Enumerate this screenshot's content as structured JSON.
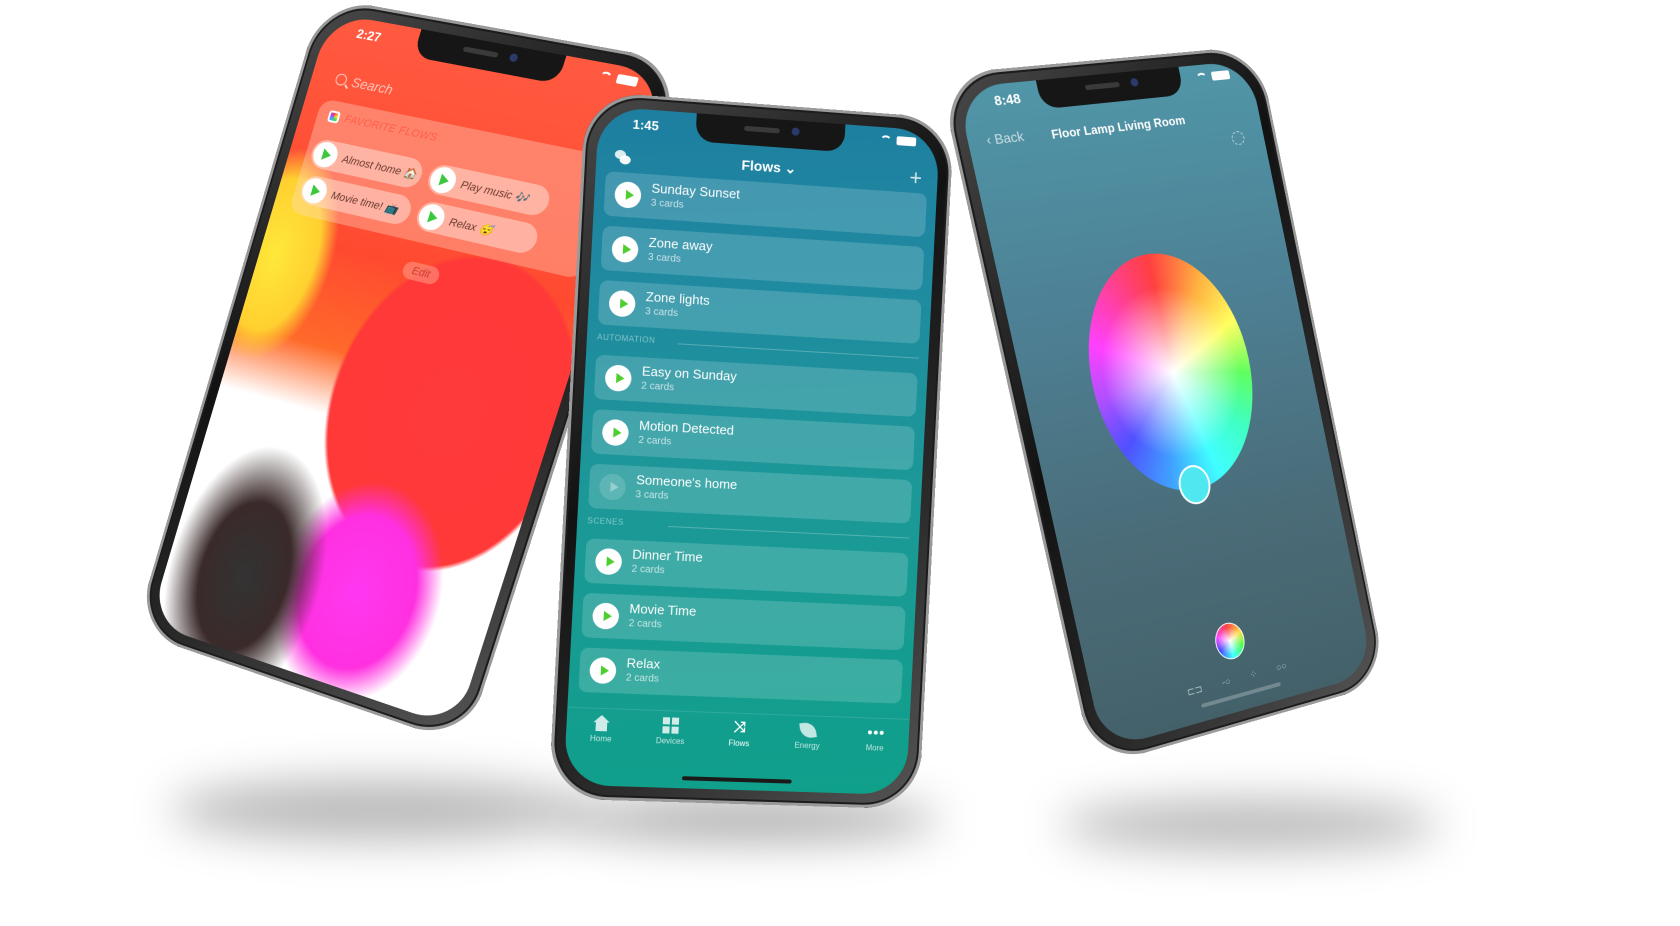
{
  "left_phone": {
    "status_time": "2:27",
    "search_placeholder": "Search",
    "widget_title": "FAVORITE FLOWS",
    "favorite_flows": [
      {
        "label": "Almost home 🏠"
      },
      {
        "label": "Play music 🎶"
      },
      {
        "label": "Movie time! 📺"
      },
      {
        "label": "Relax 😴"
      }
    ],
    "edit_label": "Edit"
  },
  "center_phone": {
    "status_time": "1:45",
    "header_title": "Flows",
    "header_chevron": "⌄",
    "add_label": "+",
    "sections": [
      {
        "title": "",
        "flows": [
          {
            "name": "Sunday Sunset",
            "cards": "3 cards",
            "enabled": true
          },
          {
            "name": "Zone away",
            "cards": "3 cards",
            "enabled": true
          },
          {
            "name": "Zone lights",
            "cards": "3 cards",
            "enabled": true
          }
        ]
      },
      {
        "title": "AUTOMATION",
        "flows": [
          {
            "name": "Easy on Sunday",
            "cards": "2 cards",
            "enabled": true
          },
          {
            "name": "Motion Detected",
            "cards": "2 cards",
            "enabled": true
          },
          {
            "name": "Someone's home",
            "cards": "3 cards",
            "enabled": false
          }
        ]
      },
      {
        "title": "SCENES",
        "flows": [
          {
            "name": "Dinner Time",
            "cards": "2 cards",
            "enabled": true
          },
          {
            "name": "Movie Time",
            "cards": "2 cards",
            "enabled": true
          },
          {
            "name": "Relax",
            "cards": "2 cards",
            "enabled": true
          }
        ]
      }
    ],
    "tabs": [
      {
        "label": "Home",
        "icon": "home-icon",
        "active": false
      },
      {
        "label": "Devices",
        "icon": "devices-icon",
        "active": false
      },
      {
        "label": "Flows",
        "icon": "flows-icon",
        "active": true
      },
      {
        "label": "Energy",
        "icon": "energy-icon",
        "active": false
      },
      {
        "label": "More",
        "icon": "more-icon",
        "active": false
      }
    ]
  },
  "right_phone": {
    "status_time": "8:48",
    "back_label": "‹ Back",
    "title": "Floor Lamp Living Room",
    "tools": [
      "⊏⊐",
      "-○",
      "⁘",
      "○○"
    ]
  }
}
